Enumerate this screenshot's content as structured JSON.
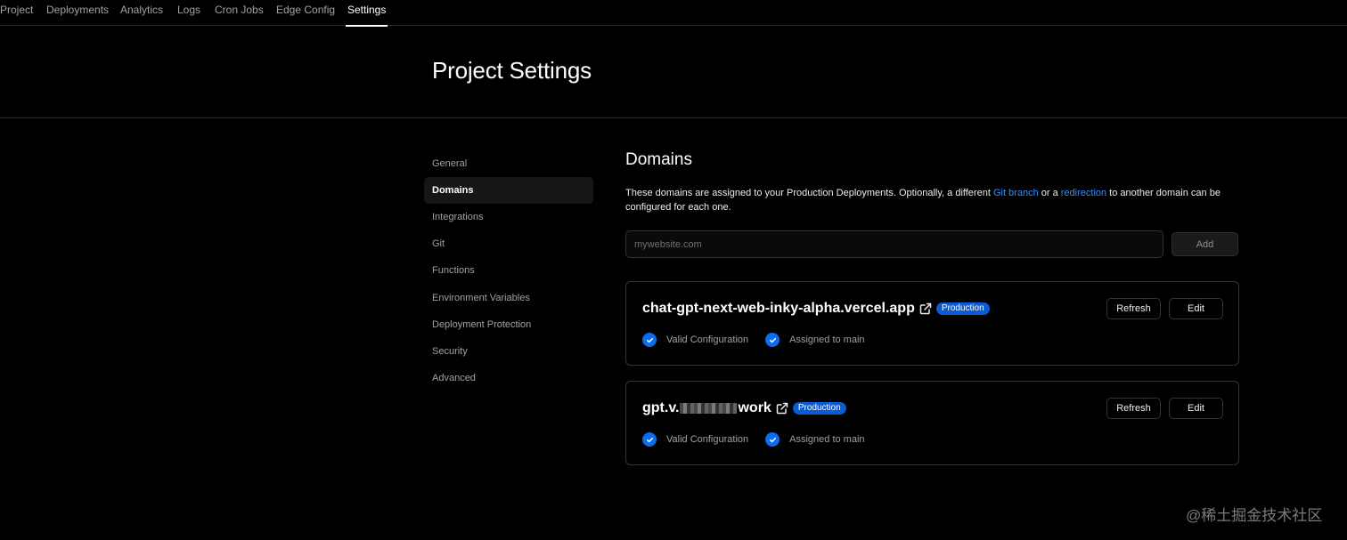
{
  "nav": {
    "tabs": [
      {
        "label": "Project"
      },
      {
        "label": "Deployments"
      },
      {
        "label": "Analytics"
      },
      {
        "label": "Logs"
      },
      {
        "label": "Cron Jobs"
      },
      {
        "label": "Edge Config"
      },
      {
        "label": "Settings",
        "active": true
      }
    ]
  },
  "page": {
    "title": "Project Settings"
  },
  "sidebar": {
    "items": [
      {
        "label": "General"
      },
      {
        "label": "Domains",
        "active": true
      },
      {
        "label": "Integrations"
      },
      {
        "label": "Git"
      },
      {
        "label": "Functions"
      },
      {
        "label": "Environment Variables"
      },
      {
        "label": "Deployment Protection"
      },
      {
        "label": "Security"
      },
      {
        "label": "Advanced"
      }
    ]
  },
  "domains": {
    "title": "Domains",
    "description": {
      "part1": "These domains are assigned to your Production Deployments. Optionally, a different ",
      "link1": "Git branch",
      "part2": " or a ",
      "link2": "redirection",
      "part3": " to another domain can be configured for each one."
    },
    "input_placeholder": "mywebsite.com",
    "input_value": "",
    "add_label": "Add",
    "cards": [
      {
        "domain": "chat-gpt-next-web-inky-alpha.vercel.app",
        "badge": "Production",
        "status1": "Valid Configuration",
        "status2": "Assigned to main",
        "refresh_label": "Refresh",
        "edit_label": "Edit"
      },
      {
        "domain_prefix": "gpt.v.",
        "domain_suffix": "work",
        "badge": "Production",
        "status1": "Valid Configuration",
        "status2": "Assigned to main",
        "refresh_label": "Refresh",
        "edit_label": "Edit"
      }
    ]
  },
  "watermark": "@稀土掘金技术社区",
  "colors": {
    "background": "#000000",
    "link": "#3291ff",
    "badge": "#0b5bd3",
    "check": "#0b6cf0"
  }
}
